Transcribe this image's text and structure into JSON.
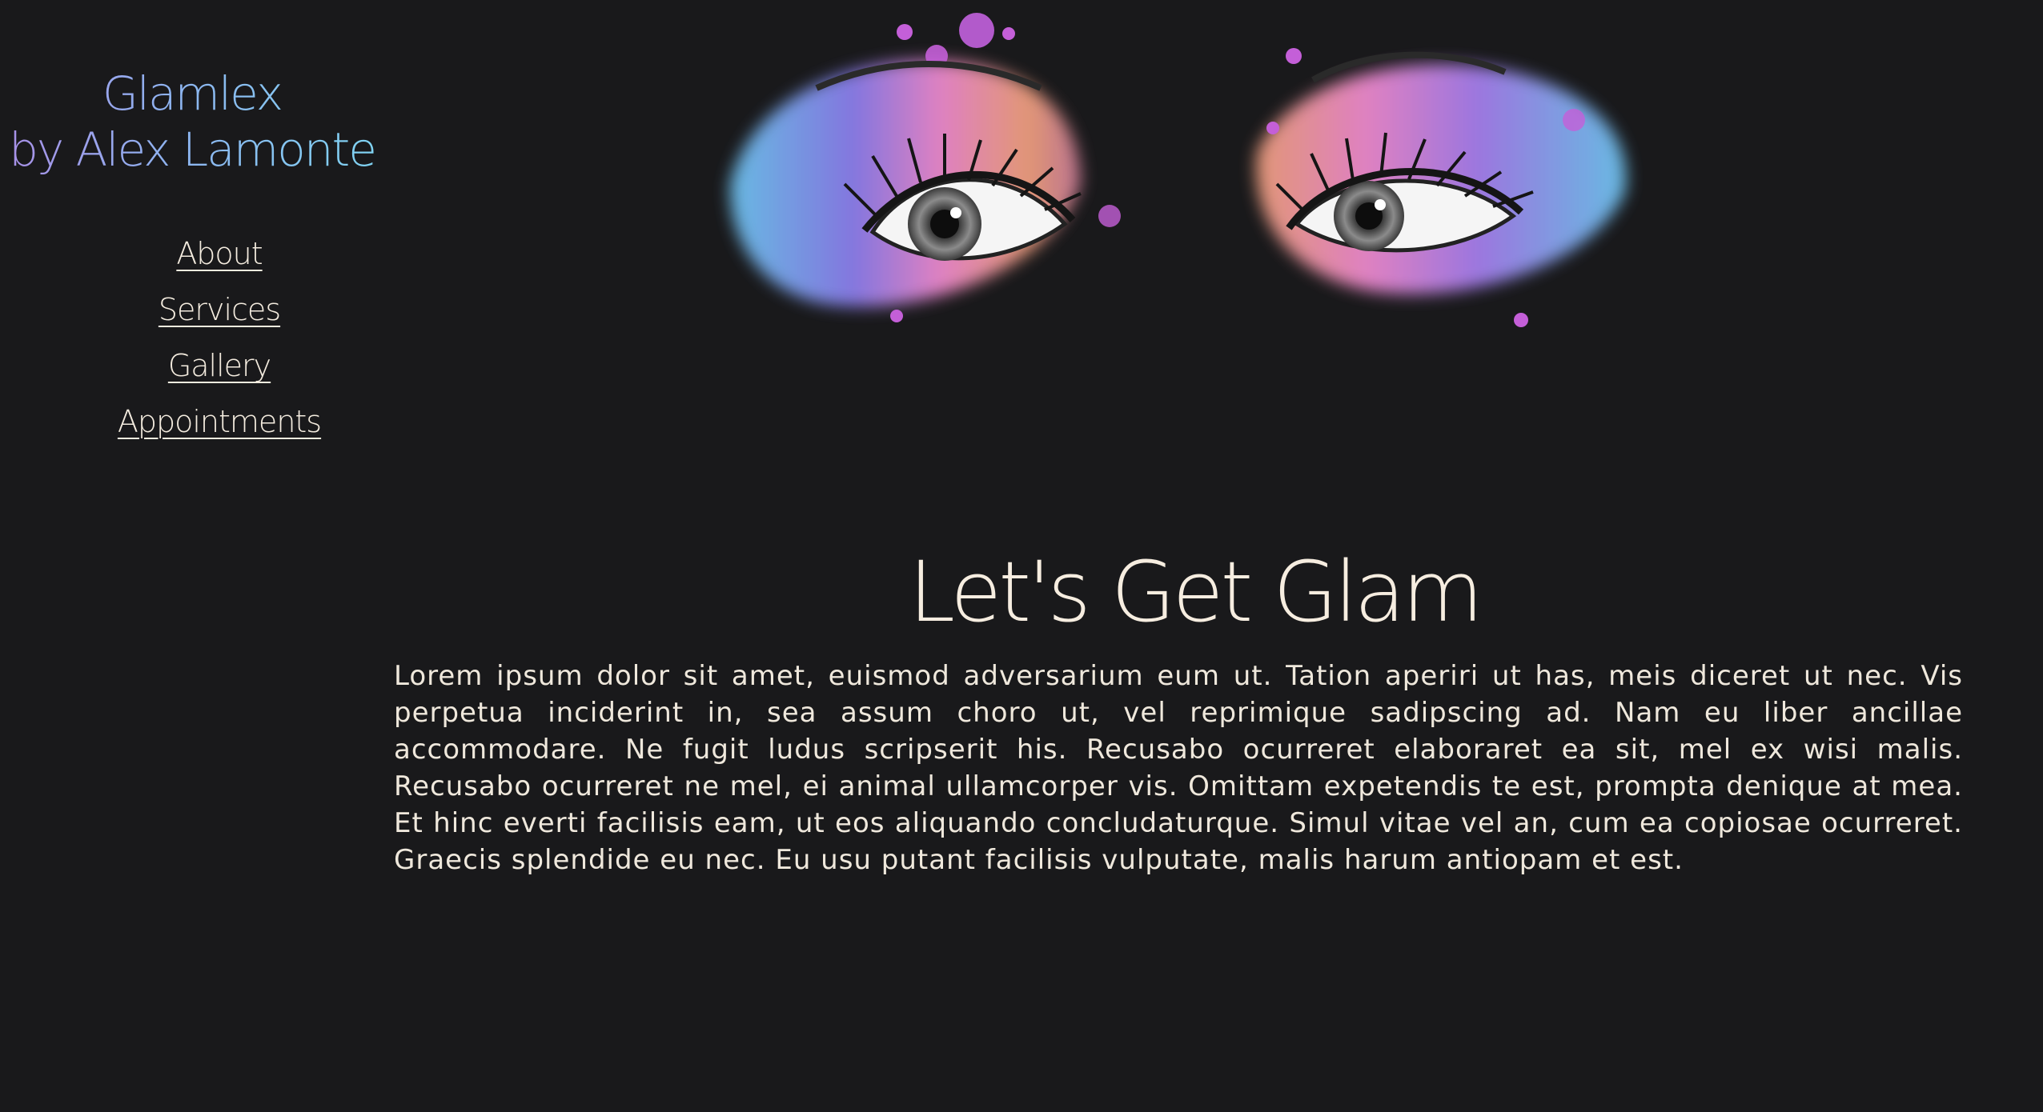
{
  "brand": {
    "line1": "Glamlex",
    "line2": "by Alex Lamonte",
    "gradient_colors": [
      "#a98fe7",
      "#8eb4f0",
      "#7fd4f2"
    ]
  },
  "nav": {
    "items": [
      {
        "label": "About"
      },
      {
        "label": "Services"
      },
      {
        "label": "Gallery"
      },
      {
        "label": "Appointments"
      }
    ]
  },
  "hero": {
    "image": "colorful-eyeshadow-eyes-illustration"
  },
  "main": {
    "headline": "Let's Get Glam",
    "paragraph": "Lorem ipsum dolor sit amet, euismod adversarium eum ut. Tation aperiri ut has, meis diceret ut nec. Vis perpetua inciderint in, sea assum choro ut, vel reprimique sadipscing ad. Nam eu liber ancillae accommodare. Ne fugit ludus scripserit his. Recusabo ocurreret elaboraret ea sit, mel ex wisi malis. Recusabo ocurreret ne mel, ei animal ullamcorper vis. Omittam expetendis te est, prompta denique at mea. Et hinc everti facilisis eam, ut eos aliquando concludaturque. Simul vitae vel an, cum ea copiosae ocurreret. Graecis splendide eu nec. Eu usu putant facilisis vulputate, malis harum antiopam et est."
  },
  "colors": {
    "background": "#19191b",
    "text": "#f3ead9"
  }
}
